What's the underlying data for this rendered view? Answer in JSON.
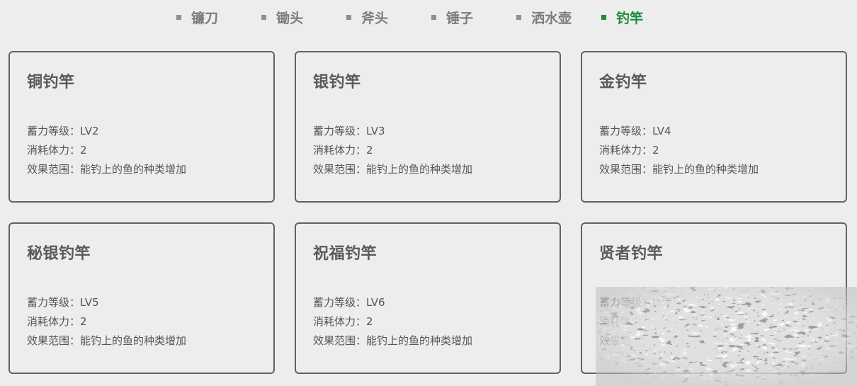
{
  "tabs": [
    {
      "label": "镰刀",
      "active": false
    },
    {
      "label": "锄头",
      "active": false
    },
    {
      "label": "斧头",
      "active": false
    },
    {
      "label": "锤子",
      "active": false
    },
    {
      "label": "洒水壶",
      "active": false
    },
    {
      "label": "钓竿",
      "active": true
    }
  ],
  "colors": {
    "background": "#ededed",
    "active_tab": "#1f8a3b",
    "inactive_tab": "#7b7b7b",
    "card_border": "#626262",
    "text": "#555555"
  },
  "cards": [
    {
      "title": "铜钓竿",
      "charge": "蓄力等级：LV2",
      "stamina": "消耗体力：2",
      "effect": "效果范围：能钓上的鱼的种类增加"
    },
    {
      "title": "银钓竿",
      "charge": "蓄力等级：LV3",
      "stamina": "消耗体力：2",
      "effect": "效果范围：能钓上的鱼的种类增加"
    },
    {
      "title": "金钓竿",
      "charge": "蓄力等级：LV4",
      "stamina": "消耗体力：2",
      "effect": "效果范围：能钓上的鱼的种类增加"
    },
    {
      "title": "秘银钓竿",
      "charge": "蓄力等级：LV5",
      "stamina": "消耗体力：2",
      "effect": "效果范围：能钓上的鱼的种类增加"
    },
    {
      "title": "祝福钓竿",
      "charge": "蓄力等级：LV6",
      "stamina": "消耗体力：2",
      "effect": "效果范围：能钓上的鱼的种类增加"
    },
    {
      "title": "贤者钓竿",
      "charge": "蓄力等级：LV7",
      "stamina": "消耗体力：",
      "effect": "效果范"
    }
  ]
}
